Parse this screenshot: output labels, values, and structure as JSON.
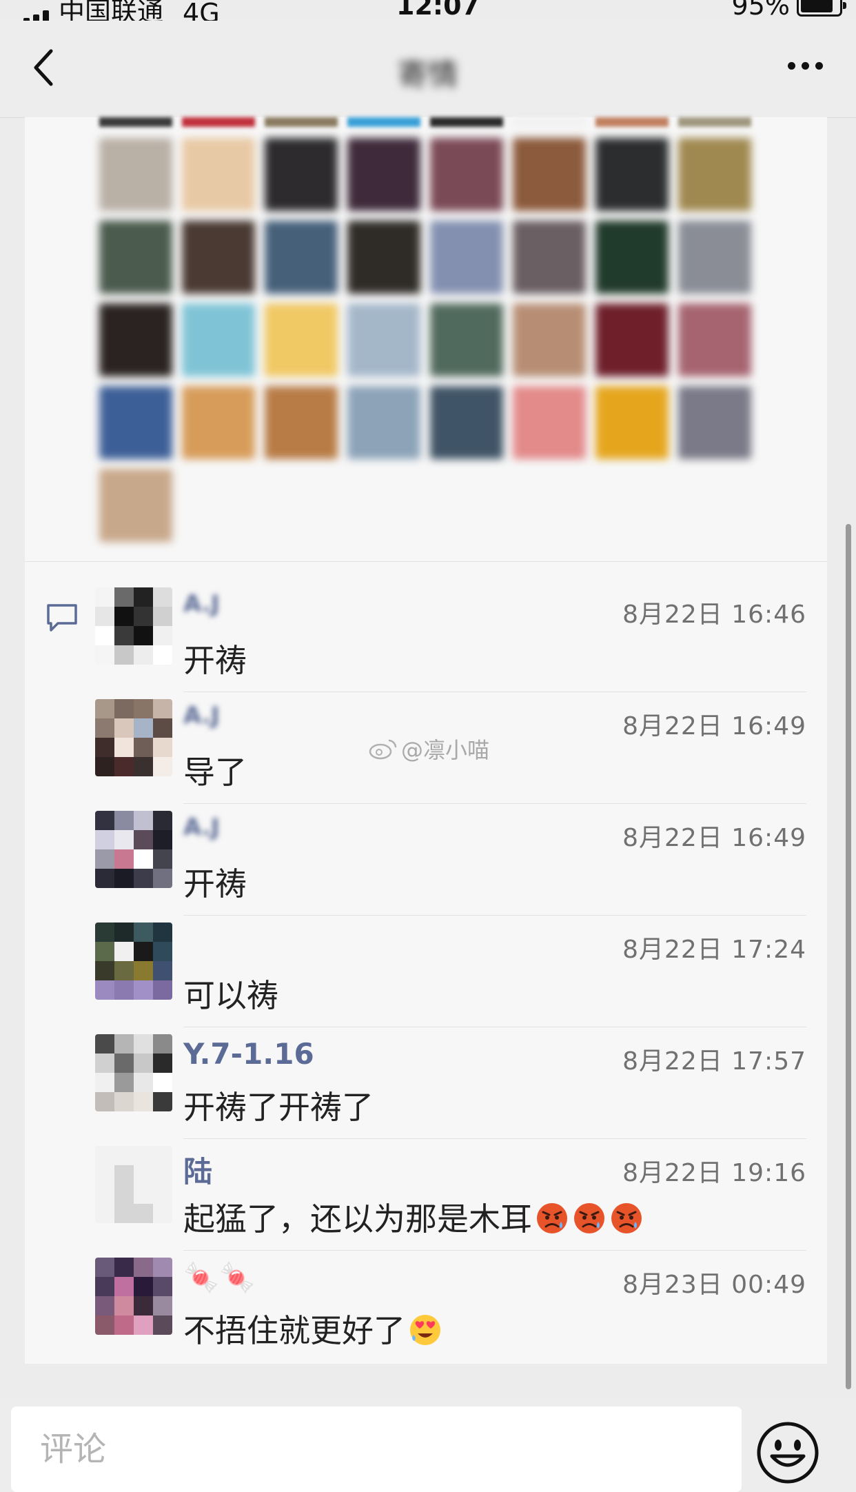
{
  "status_bar": {
    "carrier": "中国联通",
    "network": "4G",
    "time": "12:07",
    "battery": "95%",
    "battery_level": 0.95
  },
  "nav": {
    "title": "寄情",
    "back_icon": "chevron-left-icon",
    "more_icon": "more-dots-icon"
  },
  "image_grid": {
    "colors": [
      "#b9b0a6",
      "#e8c9a5",
      "#2d2b2e",
      "#3e2a3a",
      "#7b4a57",
      "#8c5a3c",
      "#2b2d2f",
      "#a08950",
      "#4b5b4d",
      "#4a3a33",
      "#46607a",
      "#2f2c28",
      "#8390b0",
      "#6a5f63",
      "#203a2b",
      "#8a8d96",
      "#2a2322",
      "#7fc4d6",
      "#f0c864",
      "#a4b7c9",
      "#516a5e",
      "#b78e74",
      "#6e1f2a",
      "#a66470",
      "#3d5f97",
      "#d79c5a",
      "#b87c46",
      "#8ca3b8",
      "#3f5466",
      "#e38a8a",
      "#e5a61e",
      "#7a7a88",
      "#c8a88a"
    ]
  },
  "comments": [
    {
      "name": "A.J",
      "time": "8月22日 16:46",
      "text": "开祷",
      "name_blurred": true,
      "avatar": [
        "#f4f4f4",
        "#6a6a6a",
        "#222",
        "#ddd",
        "#e6e6e6",
        "#111",
        "#333",
        "#d0d0d0",
        "#ffffff",
        "#3a3a3a",
        "#111",
        "#f0f0f0",
        "#f5f5f5",
        "#c8c8c8",
        "#ededed",
        "#ffffff"
      ]
    },
    {
      "name": "A.J",
      "time": "8月22日 16:49",
      "text": "导了",
      "name_blurred": true,
      "avatar": [
        "#a8988a",
        "#7c6a61",
        "#8a7468",
        "#c7b4a8",
        "#8c7a71",
        "#d9c7bb",
        "#a7b4c7",
        "#5d4b45",
        "#3e2d2a",
        "#f0e4dd",
        "#6f5e57",
        "#e8d9cf",
        "#2d2220",
        "#4a2a2a",
        "#3a3030",
        "#f3ece7"
      ]
    },
    {
      "name": "A.J",
      "time": "8月22日 16:49",
      "text": "开祷",
      "name_blurred": true,
      "avatar": [
        "#323240",
        "#8a8aa0",
        "#c0c0d0",
        "#2a2a35",
        "#d0d0e0",
        "#e8e8ee",
        "#5a4a5a",
        "#1e1e28",
        "#9a9aa8",
        "#c87890",
        "#ffffff",
        "#44444f",
        "#2b2b38",
        "#1b1b26",
        "#3c3c4a",
        "#707080"
      ]
    },
    {
      "name": "",
      "time": "8月22日 17:24",
      "text": "可以祷",
      "name_blurred": false,
      "avatar": [
        "#2a3a35",
        "#1e2a2a",
        "#3d5a60",
        "#203540",
        "#5a6a4a",
        "#f0f0f0",
        "#1a1a1a",
        "#2f4a5a",
        "#3a3a2a",
        "#6a6a40",
        "#8a7a30",
        "#405070",
        "#9a8ac0",
        "#8a7ab0",
        "#a090c8",
        "#7a6aa0"
      ]
    },
    {
      "name": "Y.7-1.16",
      "time": "8月22日 17:57",
      "text": "开祷了开祷了",
      "name_blurred": false,
      "avatar": [
        "#4a4a4a",
        "#b5b5b5",
        "#e0e0e0",
        "#8a8a8a",
        "#d0d0d0",
        "#6a6a6a",
        "#c8c8c8",
        "#2a2a2a",
        "#f0f0f0",
        "#9a9a9a",
        "#e8e8e8",
        "#ffffff",
        "#c2bdb8",
        "#dcd6d0",
        "#eae4df",
        "#3a3a3a"
      ]
    },
    {
      "name": "陆",
      "time": "8月22日 19:16",
      "text": "起猛了，还以为那是木耳",
      "name_blurred": false,
      "emojis": [
        "angry-face-icon",
        "angry-face-icon",
        "angry-face-icon"
      ],
      "avatar": [
        "#f2f2f2",
        "#f2f2f2",
        "#f2f2f2",
        "#f2f2f2",
        "#f2f2f2",
        "#d6d6d6",
        "#f2f2f2",
        "#f2f2f2",
        "#f2f2f2",
        "#d6d6d6",
        "#f2f2f2",
        "#f2f2f2",
        "#f2f2f2",
        "#d6d6d6",
        "#d6d6d6",
        "#f2f2f2"
      ]
    },
    {
      "name": "🍬🍬",
      "time": "8月23日 00:49",
      "text": "不捂住就更好了",
      "name_blurred": false,
      "emojis": [
        "heart-eyes-face-icon"
      ],
      "avatar": [
        "#6a5a7a",
        "#3a2a4a",
        "#8a6a8a",
        "#a08ab0",
        "#4a3a5a",
        "#c070a0",
        "#2a1a3a",
        "#5a4a6a",
        "#7a5a7a",
        "#d08aa0",
        "#3a2a3a",
        "#9a8aa0",
        "#8a5a6a",
        "#c06a8a",
        "#e0a0c0",
        "#5a4a5a"
      ]
    }
  ],
  "watermark": "@凛小喵",
  "input": {
    "placeholder": "评论"
  },
  "emoji_button_icon": "smiley-face-icon",
  "comment_section_icon": "comment-bubble-icon"
}
